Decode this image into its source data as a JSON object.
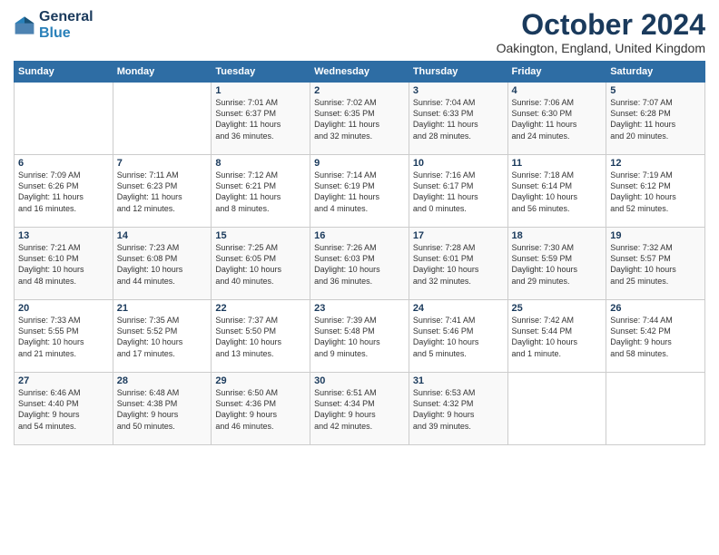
{
  "header": {
    "logo_line1": "General",
    "logo_line2": "Blue",
    "title": "October 2024",
    "location": "Oakington, England, United Kingdom"
  },
  "weekdays": [
    "Sunday",
    "Monday",
    "Tuesday",
    "Wednesday",
    "Thursday",
    "Friday",
    "Saturday"
  ],
  "weeks": [
    [
      {
        "day": "",
        "info": ""
      },
      {
        "day": "",
        "info": ""
      },
      {
        "day": "1",
        "info": "Sunrise: 7:01 AM\nSunset: 6:37 PM\nDaylight: 11 hours\nand 36 minutes."
      },
      {
        "day": "2",
        "info": "Sunrise: 7:02 AM\nSunset: 6:35 PM\nDaylight: 11 hours\nand 32 minutes."
      },
      {
        "day": "3",
        "info": "Sunrise: 7:04 AM\nSunset: 6:33 PM\nDaylight: 11 hours\nand 28 minutes."
      },
      {
        "day": "4",
        "info": "Sunrise: 7:06 AM\nSunset: 6:30 PM\nDaylight: 11 hours\nand 24 minutes."
      },
      {
        "day": "5",
        "info": "Sunrise: 7:07 AM\nSunset: 6:28 PM\nDaylight: 11 hours\nand 20 minutes."
      }
    ],
    [
      {
        "day": "6",
        "info": "Sunrise: 7:09 AM\nSunset: 6:26 PM\nDaylight: 11 hours\nand 16 minutes."
      },
      {
        "day": "7",
        "info": "Sunrise: 7:11 AM\nSunset: 6:23 PM\nDaylight: 11 hours\nand 12 minutes."
      },
      {
        "day": "8",
        "info": "Sunrise: 7:12 AM\nSunset: 6:21 PM\nDaylight: 11 hours\nand 8 minutes."
      },
      {
        "day": "9",
        "info": "Sunrise: 7:14 AM\nSunset: 6:19 PM\nDaylight: 11 hours\nand 4 minutes."
      },
      {
        "day": "10",
        "info": "Sunrise: 7:16 AM\nSunset: 6:17 PM\nDaylight: 11 hours\nand 0 minutes."
      },
      {
        "day": "11",
        "info": "Sunrise: 7:18 AM\nSunset: 6:14 PM\nDaylight: 10 hours\nand 56 minutes."
      },
      {
        "day": "12",
        "info": "Sunrise: 7:19 AM\nSunset: 6:12 PM\nDaylight: 10 hours\nand 52 minutes."
      }
    ],
    [
      {
        "day": "13",
        "info": "Sunrise: 7:21 AM\nSunset: 6:10 PM\nDaylight: 10 hours\nand 48 minutes."
      },
      {
        "day": "14",
        "info": "Sunrise: 7:23 AM\nSunset: 6:08 PM\nDaylight: 10 hours\nand 44 minutes."
      },
      {
        "day": "15",
        "info": "Sunrise: 7:25 AM\nSunset: 6:05 PM\nDaylight: 10 hours\nand 40 minutes."
      },
      {
        "day": "16",
        "info": "Sunrise: 7:26 AM\nSunset: 6:03 PM\nDaylight: 10 hours\nand 36 minutes."
      },
      {
        "day": "17",
        "info": "Sunrise: 7:28 AM\nSunset: 6:01 PM\nDaylight: 10 hours\nand 32 minutes."
      },
      {
        "day": "18",
        "info": "Sunrise: 7:30 AM\nSunset: 5:59 PM\nDaylight: 10 hours\nand 29 minutes."
      },
      {
        "day": "19",
        "info": "Sunrise: 7:32 AM\nSunset: 5:57 PM\nDaylight: 10 hours\nand 25 minutes."
      }
    ],
    [
      {
        "day": "20",
        "info": "Sunrise: 7:33 AM\nSunset: 5:55 PM\nDaylight: 10 hours\nand 21 minutes."
      },
      {
        "day": "21",
        "info": "Sunrise: 7:35 AM\nSunset: 5:52 PM\nDaylight: 10 hours\nand 17 minutes."
      },
      {
        "day": "22",
        "info": "Sunrise: 7:37 AM\nSunset: 5:50 PM\nDaylight: 10 hours\nand 13 minutes."
      },
      {
        "day": "23",
        "info": "Sunrise: 7:39 AM\nSunset: 5:48 PM\nDaylight: 10 hours\nand 9 minutes."
      },
      {
        "day": "24",
        "info": "Sunrise: 7:41 AM\nSunset: 5:46 PM\nDaylight: 10 hours\nand 5 minutes."
      },
      {
        "day": "25",
        "info": "Sunrise: 7:42 AM\nSunset: 5:44 PM\nDaylight: 10 hours\nand 1 minute."
      },
      {
        "day": "26",
        "info": "Sunrise: 7:44 AM\nSunset: 5:42 PM\nDaylight: 9 hours\nand 58 minutes."
      }
    ],
    [
      {
        "day": "27",
        "info": "Sunrise: 6:46 AM\nSunset: 4:40 PM\nDaylight: 9 hours\nand 54 minutes."
      },
      {
        "day": "28",
        "info": "Sunrise: 6:48 AM\nSunset: 4:38 PM\nDaylight: 9 hours\nand 50 minutes."
      },
      {
        "day": "29",
        "info": "Sunrise: 6:50 AM\nSunset: 4:36 PM\nDaylight: 9 hours\nand 46 minutes."
      },
      {
        "day": "30",
        "info": "Sunrise: 6:51 AM\nSunset: 4:34 PM\nDaylight: 9 hours\nand 42 minutes."
      },
      {
        "day": "31",
        "info": "Sunrise: 6:53 AM\nSunset: 4:32 PM\nDaylight: 9 hours\nand 39 minutes."
      },
      {
        "day": "",
        "info": ""
      },
      {
        "day": "",
        "info": ""
      }
    ]
  ]
}
